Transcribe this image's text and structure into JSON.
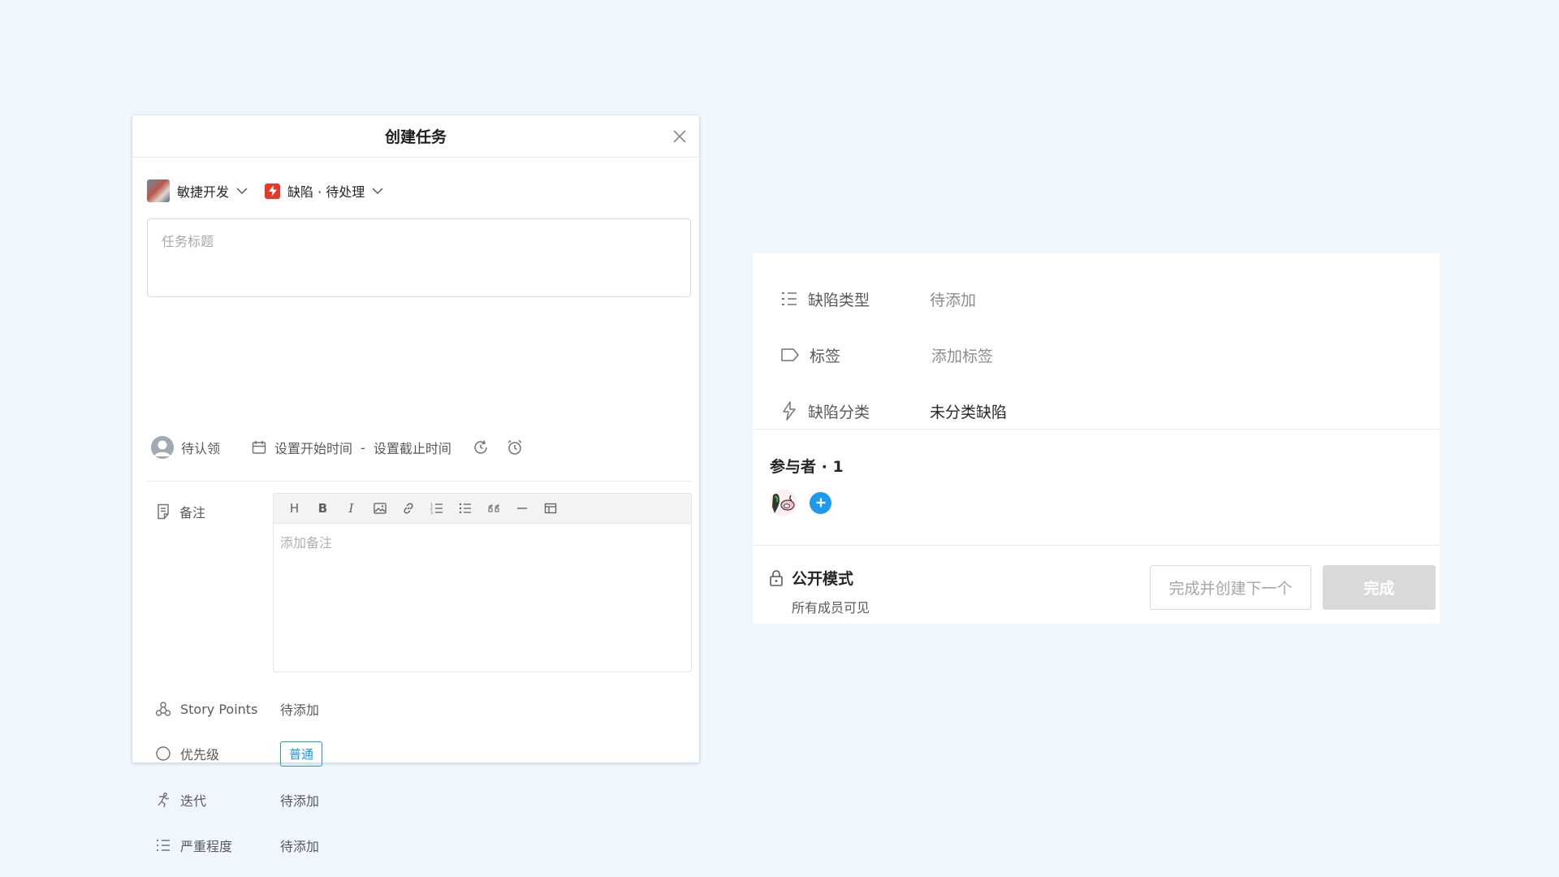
{
  "dialog": {
    "title": "创建任务",
    "project": {
      "name": "敏捷开发",
      "icon": "project-avatar"
    },
    "task_type": {
      "label": "缺陷 · 待处理",
      "badge_color": "#e6392b",
      "icon": "lightning-icon"
    },
    "title_input": {
      "placeholder": "任务标题",
      "value": ""
    },
    "assignee": {
      "label": "待认领"
    },
    "dates": {
      "start": "设置开始时间",
      "separator": "-",
      "end": "设置截止时间"
    },
    "notes": {
      "label": "备注",
      "placeholder": "添加备注",
      "toolbar": [
        "H",
        "B",
        "I",
        "image",
        "link",
        "ordered-list",
        "bullet-list",
        "quote",
        "divider",
        "table"
      ]
    },
    "properties": [
      {
        "label": "Story Points",
        "value": "待添加",
        "icon": "story-points-icon"
      },
      {
        "label": "优先级",
        "value": "普通",
        "icon": "priority-circle-icon",
        "tag_color": "#1b9aee"
      },
      {
        "label": "迭代",
        "value": "待添加",
        "icon": "sprint-icon"
      },
      {
        "label": "严重程度",
        "value": "待添加",
        "icon": "list-icon"
      }
    ]
  },
  "panel": {
    "fields": [
      {
        "label": "缺陷类型",
        "value": "待添加",
        "icon": "list-icon"
      },
      {
        "label": "标签",
        "value": "添加标签",
        "icon": "tag-icon"
      },
      {
        "label": "缺陷分类",
        "value": "未分类缺陷",
        "icon": "lightning-outline-icon"
      }
    ],
    "participants": {
      "title": "参与者 · 1"
    },
    "visibility": {
      "title": "公开模式",
      "subtitle": "所有成员可见"
    },
    "buttons": {
      "create_next": "完成并创建下一个",
      "done": "完成"
    },
    "accent_color": "#1b9aee"
  }
}
